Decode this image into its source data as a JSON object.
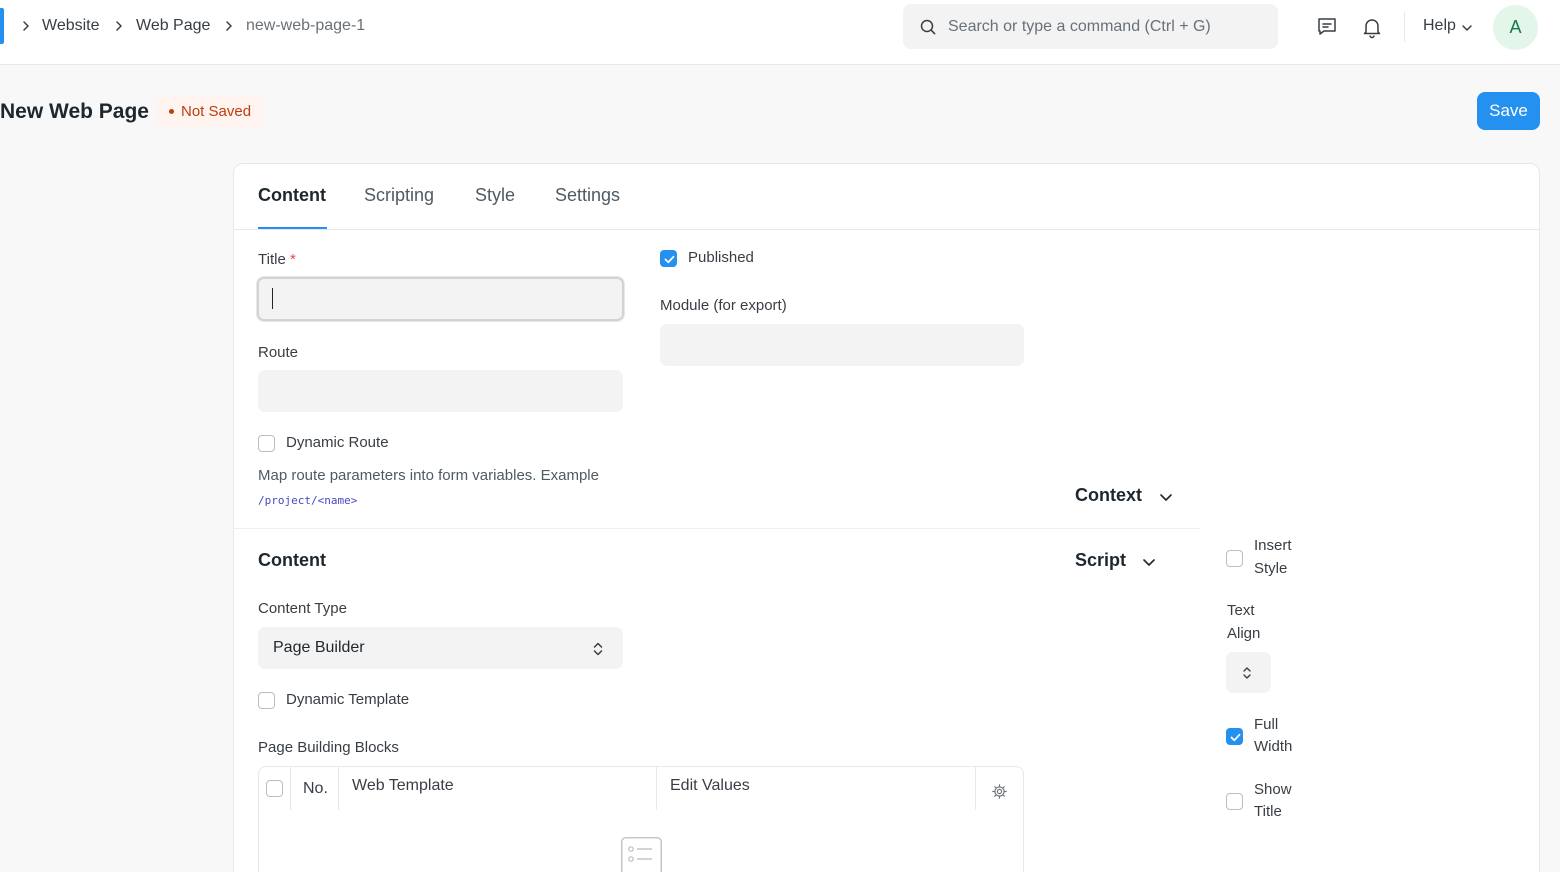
{
  "breadcrumbs": [
    {
      "label": "Website"
    },
    {
      "label": "Web Page"
    },
    {
      "label": "new-web-page-1"
    }
  ],
  "navbar": {
    "search_placeholder": "Search or type a command (Ctrl + G)",
    "help_label": "Help",
    "avatar_initial": "A"
  },
  "page": {
    "title": "New Web Page",
    "status": "Not Saved",
    "save_label": "Save"
  },
  "tabs": [
    {
      "label": "Content",
      "active": true
    },
    {
      "label": "Scripting",
      "active": false
    },
    {
      "label": "Style",
      "active": false
    },
    {
      "label": "Settings",
      "active": false
    }
  ],
  "form": {
    "title_label": "Title",
    "title_required": "*",
    "title_value": "",
    "published_label": "Published",
    "published_checked": true,
    "module_label": "Module (for export)",
    "module_value": "",
    "route_label": "Route",
    "route_value": "",
    "dynamic_route_label": "Dynamic Route",
    "dynamic_route_checked": false,
    "dynamic_route_help": "Map route parameters into form variables. Example",
    "dynamic_route_example": "/project/<name>",
    "context_section": "Context",
    "script_section": "Script",
    "content_section": "Content",
    "content_type_label": "Content Type",
    "content_type_value": "Page Builder",
    "dynamic_template_label": "Dynamic Template",
    "dynamic_template_checked": false,
    "page_blocks_label": "Page Building Blocks",
    "grid_columns": {
      "no": "No.",
      "web_template": "Web Template",
      "edit_values": "Edit Values"
    }
  },
  "side_options": {
    "insert_style_line1": "Insert",
    "insert_style_line2": "Style",
    "insert_style_checked": false,
    "text_align_line1": "Text",
    "text_align_line2": "Align",
    "text_align_value": "",
    "full_width_line1": "Full",
    "full_width_line2": "Width",
    "full_width_checked": true,
    "show_title_line1": "Show",
    "show_title_line2": "Title",
    "show_title_checked": false
  },
  "colors": {
    "primary": "#2490ef",
    "not_saved_bg": "#fff4f0",
    "not_saved_text": "#bd3e0c",
    "avatar_bg": "#e4f5e9",
    "avatar_text": "#16794c"
  },
  "icons": {
    "search": "search-icon",
    "chat": "chat-icon",
    "notifications": "bell-icon",
    "chevron": "chevron-down-icon",
    "breadcrumb": "chevron-right-icon",
    "settings": "gear-icon",
    "empty_list": "list-icon"
  }
}
